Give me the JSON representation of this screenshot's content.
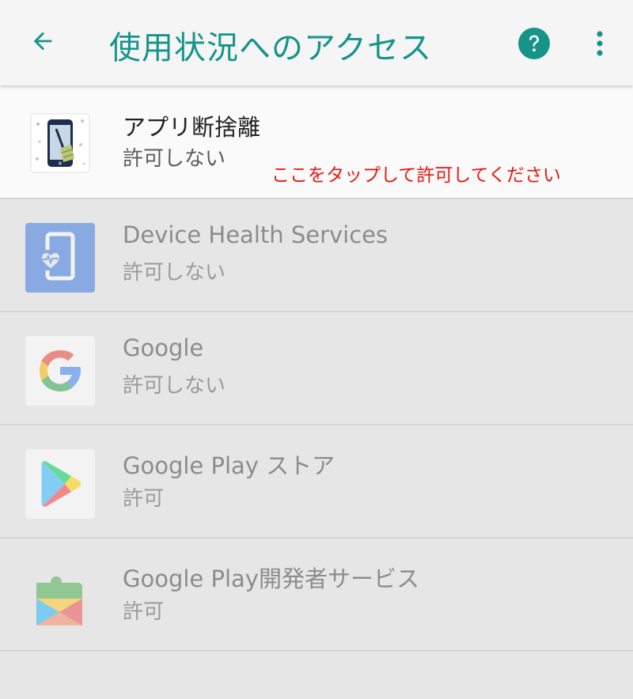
{
  "header": {
    "title": "使用状況へのアクセス",
    "back_icon": "arrow-back-icon",
    "help_icon": "help-circle-icon",
    "more_icon": "more-vert-icon"
  },
  "apps": [
    {
      "name": "アプリ断捨離",
      "status": "許可しない",
      "icon": "app-cleanup-icon",
      "hint": "ここをタップして許可してください"
    },
    {
      "name": "Device Health Services",
      "status": "許可しない",
      "icon": "device-health-icon"
    },
    {
      "name": "Google",
      "status": "許可しない",
      "icon": "google-g-icon"
    },
    {
      "name": "Google Play ストア",
      "status": "許可",
      "icon": "play-store-icon"
    },
    {
      "name": "Google Play開発者サービス",
      "status": "許可",
      "icon": "play-services-icon"
    }
  ],
  "colors": {
    "accent": "#16948a",
    "hint": "#e8190e",
    "appbar_bg": "#f5f5f5",
    "list_bg": "#e6e6e6"
  }
}
